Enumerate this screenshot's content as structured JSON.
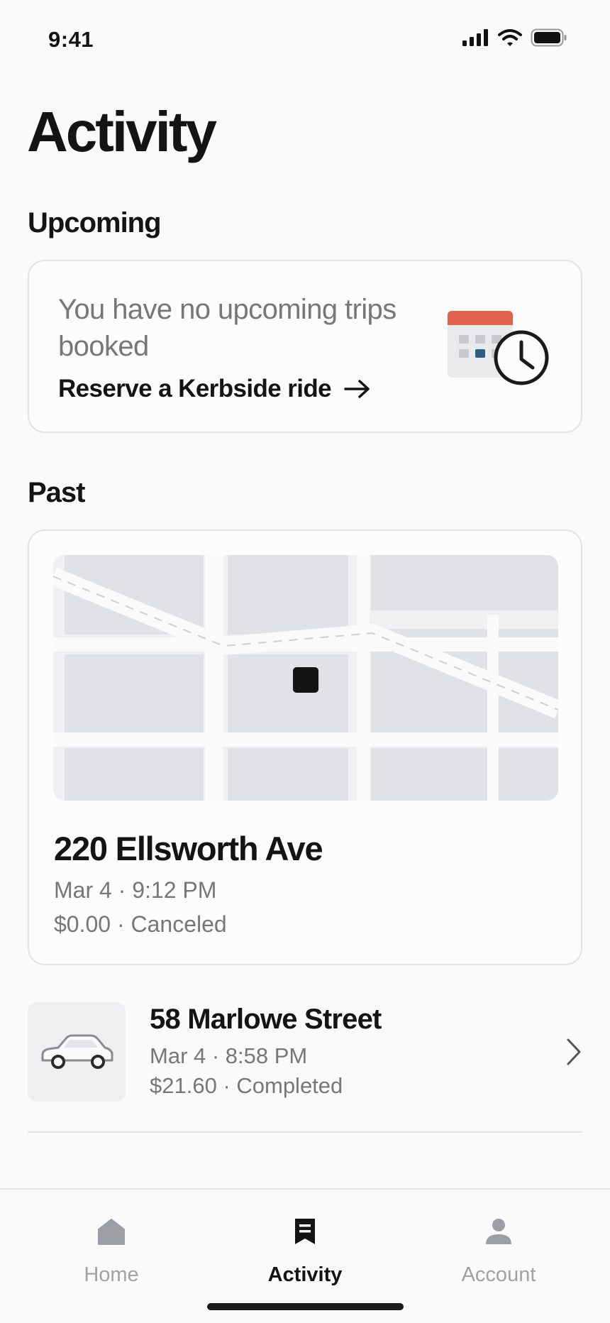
{
  "status_bar": {
    "time": "9:41"
  },
  "page": {
    "title": "Activity"
  },
  "upcoming": {
    "section_title": "Upcoming",
    "empty_message": "You have no upcoming trips booked",
    "reserve_link": "Reserve a Kerbside ride",
    "illustration_icon": "calendar-clock-icon"
  },
  "past": {
    "section_title": "Past",
    "featured_ride": {
      "address": "220 Ellsworth Ave",
      "datetime": "Mar 4 · 9:12 PM",
      "fare_status": "$0.00 · Canceled"
    },
    "rides": [
      {
        "address": "58 Marlowe Street",
        "datetime": "Mar 4 · 8:58 PM",
        "fare_status": "$21.60 · Completed",
        "icon": "car-icon"
      }
    ]
  },
  "tab_bar": {
    "tabs": [
      {
        "label": "Home",
        "icon": "home-icon",
        "active": false
      },
      {
        "label": "Activity",
        "icon": "receipt-icon",
        "active": true
      },
      {
        "label": "Account",
        "icon": "person-icon",
        "active": false
      }
    ]
  },
  "colors": {
    "accent_red": "#e0604a",
    "calendar_blue": "#2e5d85",
    "text_primary": "#141414",
    "text_secondary": "#77777b"
  }
}
